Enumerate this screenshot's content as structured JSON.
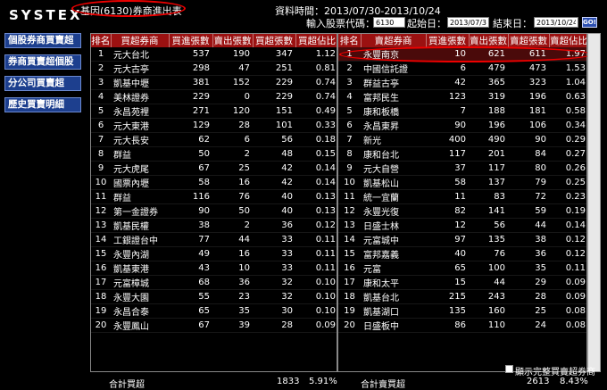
{
  "header": {
    "logo": "SYSTEX",
    "title": "基因(6130)券商進出表",
    "date_range": "資料時間：2013/07/30-2013/10/24"
  },
  "query": {
    "stock_label": "輸入股票代碼：",
    "stock_value": "6130",
    "start_label": "起始日：",
    "start_value": "2013/07/30",
    "end_label": "結束日：",
    "end_value": "2013/10/24",
    "go_label": "GO!"
  },
  "sidebar": {
    "items": [
      {
        "label": "個股券商買賣超"
      },
      {
        "label": "券商買賣超個股"
      },
      {
        "label": "分公司買賣超"
      },
      {
        "label": "歷史買賣明細"
      }
    ]
  },
  "left_table": {
    "headers": [
      "排名",
      "買超券商",
      "買進張數",
      "賣出張數",
      "買超張數",
      "買超佔比"
    ],
    "rows": [
      [
        "1",
        "元大台北",
        "537",
        "190",
        "347",
        "1.12"
      ],
      [
        "2",
        "元大古亭",
        "298",
        "47",
        "251",
        "0.81"
      ],
      [
        "3",
        "凱基中壢",
        "381",
        "152",
        "229",
        "0.74"
      ],
      [
        "4",
        "美林證券",
        "229",
        "0",
        "229",
        "0.74"
      ],
      [
        "5",
        "永昌苑裡",
        "271",
        "120",
        "151",
        "0.49"
      ],
      [
        "6",
        "元大東港",
        "129",
        "28",
        "101",
        "0.33"
      ],
      [
        "7",
        "元大長安",
        "62",
        "6",
        "56",
        "0.18"
      ],
      [
        "8",
        "群益",
        "50",
        "2",
        "48",
        "0.15"
      ],
      [
        "9",
        "元大虎尾",
        "67",
        "25",
        "42",
        "0.14"
      ],
      [
        "10",
        "國票內壢",
        "58",
        "16",
        "42",
        "0.14"
      ],
      [
        "11",
        "群益",
        "116",
        "76",
        "40",
        "0.13"
      ],
      [
        "12",
        "第一金證券",
        "90",
        "50",
        "40",
        "0.13"
      ],
      [
        "13",
        "凱基民權",
        "38",
        "2",
        "36",
        "0.12"
      ],
      [
        "14",
        "工銀證台中",
        "77",
        "44",
        "33",
        "0.11"
      ],
      [
        "15",
        "永豐內湖",
        "49",
        "16",
        "33",
        "0.11"
      ],
      [
        "16",
        "凱基東港",
        "43",
        "10",
        "33",
        "0.11"
      ],
      [
        "17",
        "元富樟城",
        "68",
        "36",
        "32",
        "0.10"
      ],
      [
        "18",
        "永豐大園",
        "55",
        "23",
        "32",
        "0.10"
      ],
      [
        "19",
        "永昌合泰",
        "65",
        "35",
        "30",
        "0.10"
      ],
      [
        "20",
        "永豐鳳山",
        "67",
        "39",
        "28",
        "0.09"
      ]
    ],
    "total_label": "合計買超",
    "total_value": "1833",
    "total_pct": "5.91%"
  },
  "right_table": {
    "headers": [
      "排名",
      "賣超券商",
      "買進張數",
      "賣出張數",
      "賣超張數",
      "賣超佔比"
    ],
    "rows": [
      [
        "1",
        "永豐南京",
        "10",
        "621",
        "611",
        "1.97"
      ],
      [
        "2",
        "中國信託證",
        "6",
        "479",
        "473",
        "1.53"
      ],
      [
        "3",
        "群益古亭",
        "42",
        "365",
        "323",
        "1.04"
      ],
      [
        "4",
        "富邦民生",
        "123",
        "319",
        "196",
        "0.63"
      ],
      [
        "5",
        "康和板橋",
        "7",
        "188",
        "181",
        "0.58"
      ],
      [
        "6",
        "永昌東昇",
        "90",
        "196",
        "106",
        "0.34"
      ],
      [
        "7",
        "新光",
        "400",
        "490",
        "90",
        "0.29"
      ],
      [
        "8",
        "康和台北",
        "117",
        "201",
        "84",
        "0.27"
      ],
      [
        "9",
        "元大自營",
        "37",
        "117",
        "80",
        "0.26"
      ],
      [
        "10",
        "凱基松山",
        "58",
        "137",
        "79",
        "0.25"
      ],
      [
        "11",
        "統一宜蘭",
        "11",
        "83",
        "72",
        "0.23"
      ],
      [
        "12",
        "永豐光復",
        "82",
        "141",
        "59",
        "0.19"
      ],
      [
        "13",
        "日盛士林",
        "12",
        "56",
        "44",
        "0.14"
      ],
      [
        "14",
        "元富城中",
        "97",
        "135",
        "38",
        "0.12"
      ],
      [
        "15",
        "富邦嘉義",
        "40",
        "76",
        "36",
        "0.12"
      ],
      [
        "16",
        "元富",
        "65",
        "100",
        "35",
        "0.11"
      ],
      [
        "17",
        "康和太平",
        "15",
        "44",
        "29",
        "0.09"
      ],
      [
        "18",
        "凱基台北",
        "215",
        "243",
        "28",
        "0.09"
      ],
      [
        "19",
        "凱基湖口",
        "135",
        "160",
        "25",
        "0.08"
      ],
      [
        "20",
        "日盛板中",
        "86",
        "110",
        "24",
        "0.08"
      ]
    ],
    "total_label": "合計賣買超",
    "total_value": "2613",
    "total_pct": "8.43%"
  },
  "footer": {
    "checkbox_label": "顯示完整買賣超券商"
  },
  "colors": {
    "header_red": "#9b1111",
    "sidebar_blue": "#1d3f8e",
    "highlight_red": "#e00000"
  }
}
